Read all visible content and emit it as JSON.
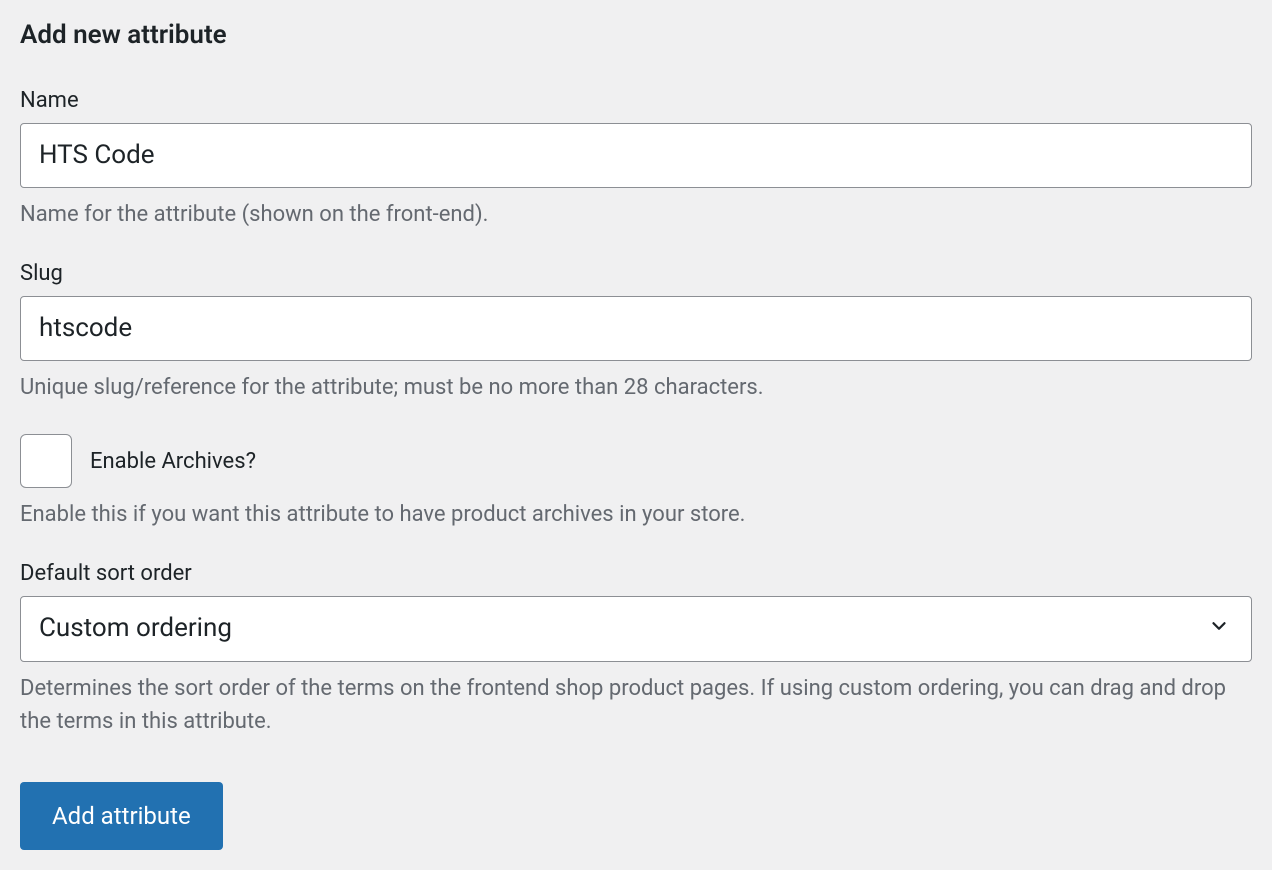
{
  "form": {
    "title": "Add new attribute",
    "name": {
      "label": "Name",
      "value": "HTS Code",
      "help": "Name for the attribute (shown on the front-end)."
    },
    "slug": {
      "label": "Slug",
      "value": "htscode",
      "help": "Unique slug/reference for the attribute; must be no more than 28 characters."
    },
    "archives": {
      "label": "Enable Archives?",
      "help": "Enable this if you want this attribute to have product archives in your store."
    },
    "sort_order": {
      "label": "Default sort order",
      "selected": "Custom ordering",
      "help": "Determines the sort order of the terms on the frontend shop product pages. If using custom ordering, you can drag and drop the terms in this attribute."
    },
    "submit_label": "Add attribute"
  }
}
